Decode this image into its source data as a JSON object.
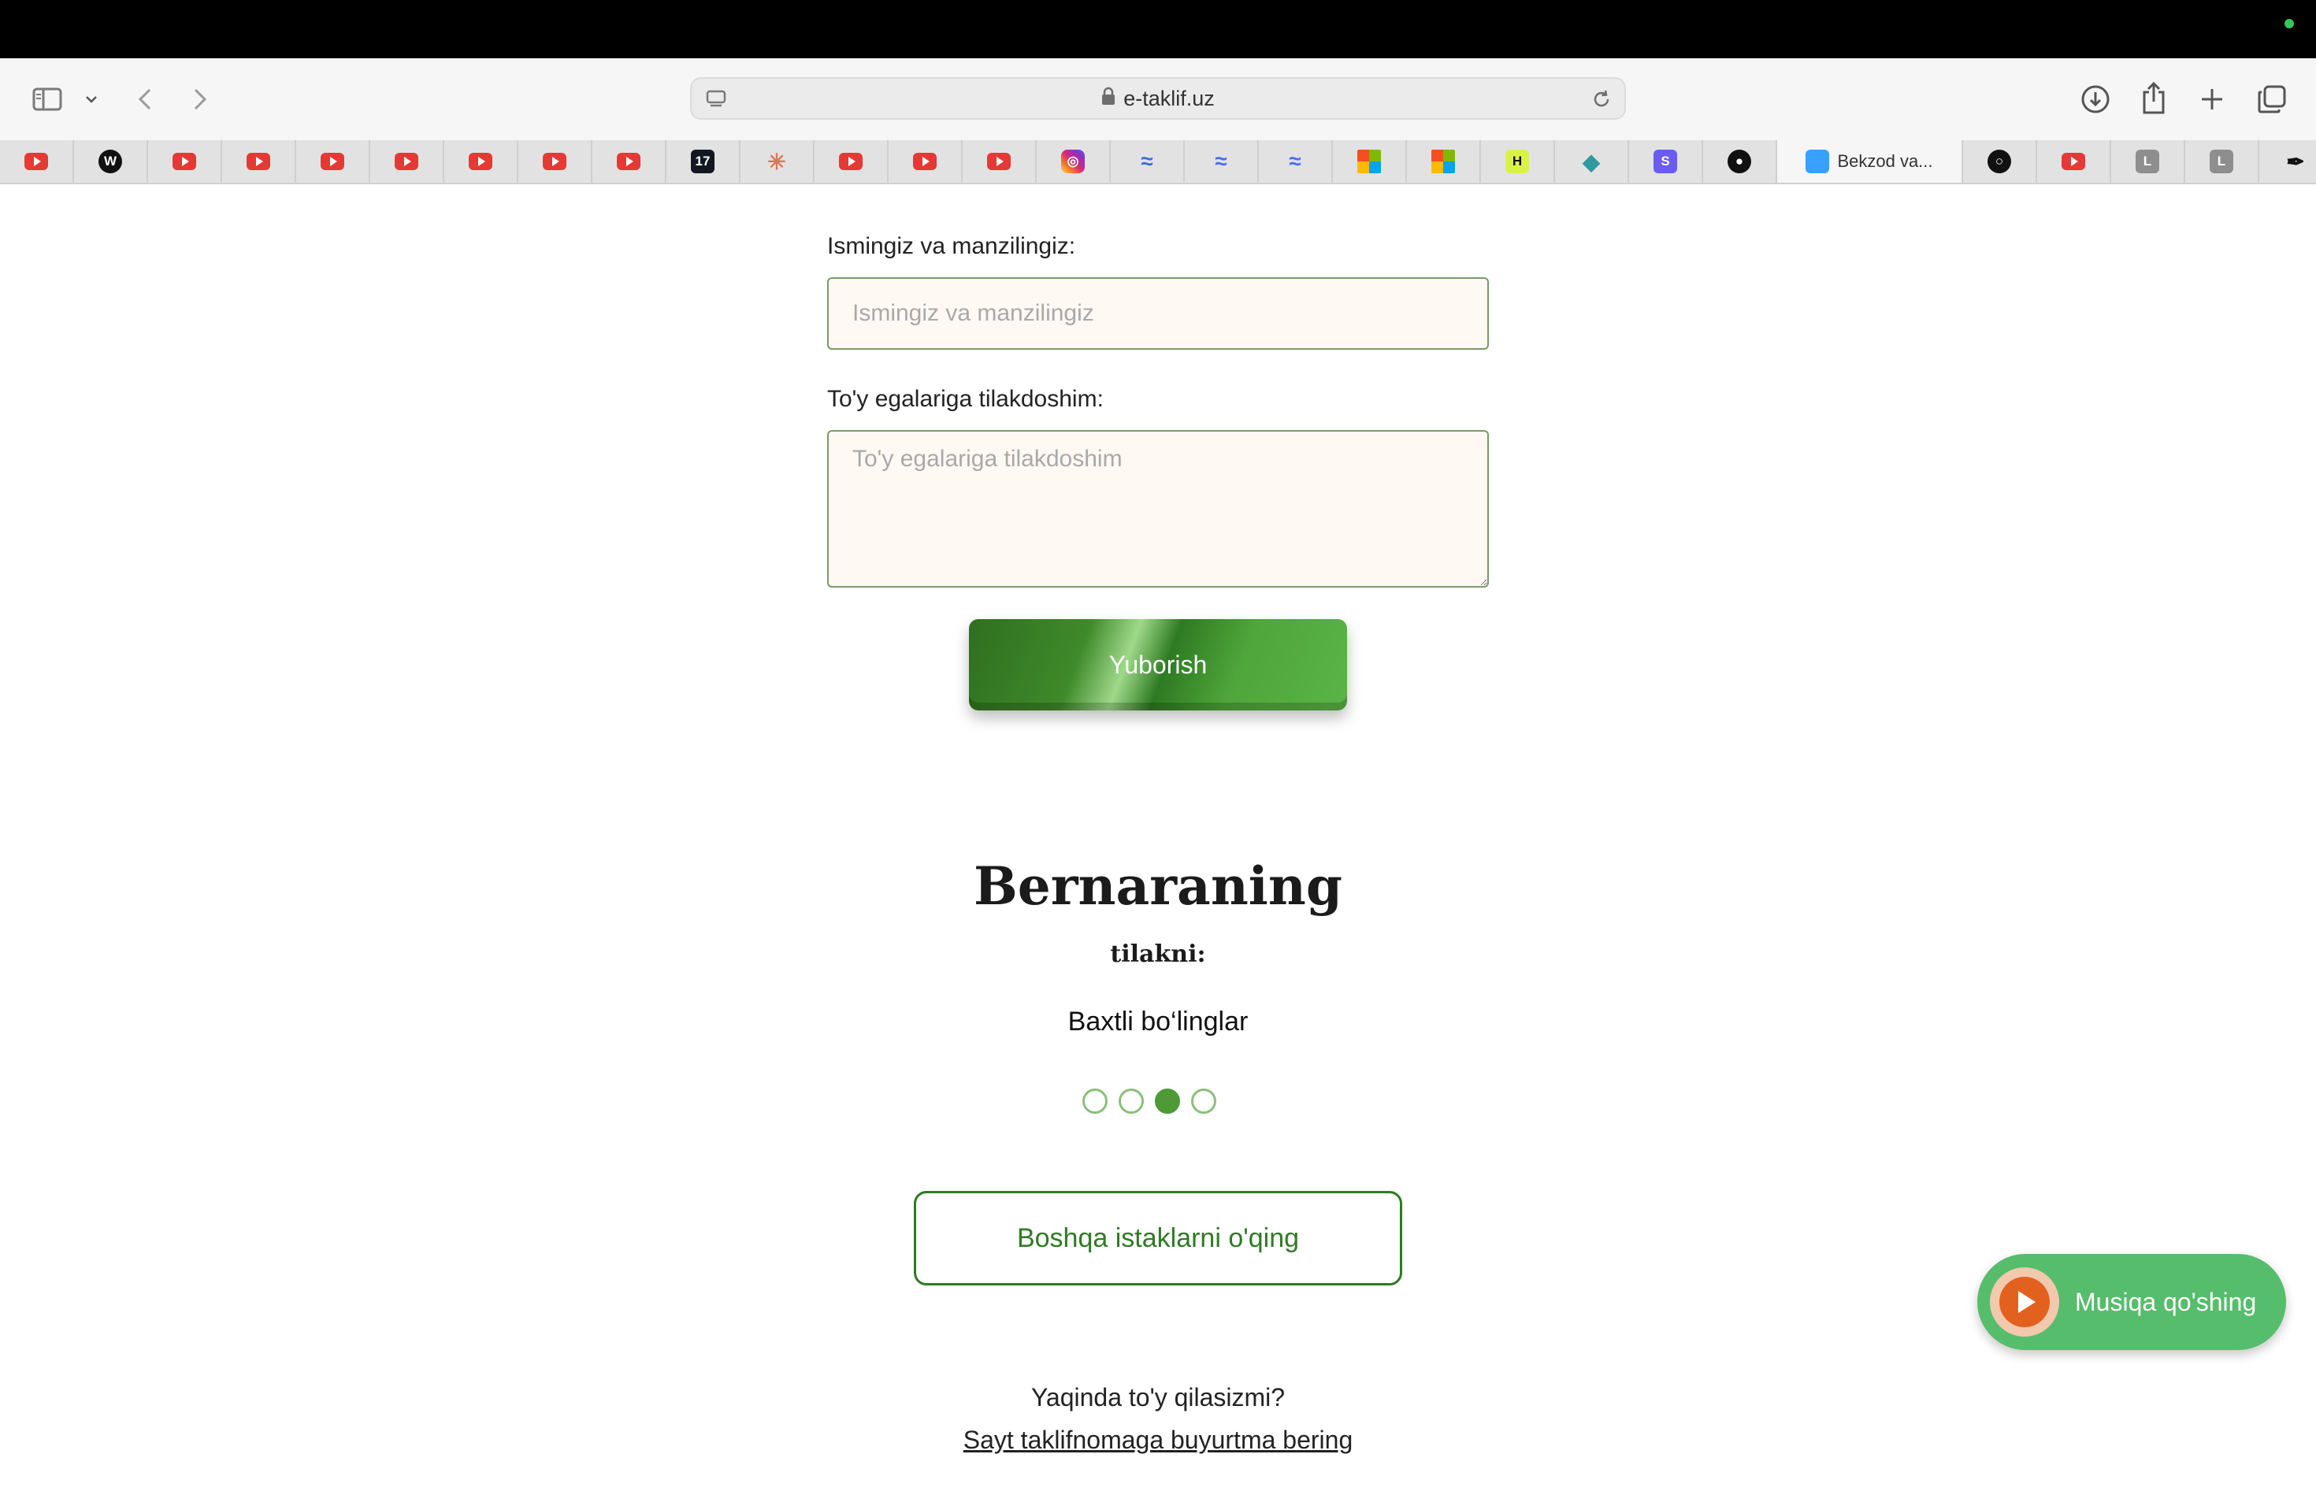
{
  "browser": {
    "url": "e-taklif.uz",
    "tabs": [
      {
        "icon": "youtube-icon",
        "color": "#e53935"
      },
      {
        "icon": "w-logo-icon",
        "text": "W",
        "color": "#111111"
      },
      {
        "icon": "youtube-icon",
        "color": "#e53935"
      },
      {
        "icon": "youtube-icon",
        "color": "#e53935"
      },
      {
        "icon": "youtube-icon",
        "color": "#e53935"
      },
      {
        "icon": "youtube-icon",
        "color": "#e53935"
      },
      {
        "icon": "youtube-icon",
        "color": "#e53935"
      },
      {
        "icon": "youtube-icon",
        "color": "#e53935"
      },
      {
        "icon": "youtube-icon",
        "color": "#e53935"
      },
      {
        "icon": "tradingview-icon",
        "text": "17",
        "color": "#131722"
      },
      {
        "icon": "claude-icon",
        "text": "✳",
        "color": "#d97757"
      },
      {
        "icon": "youtube-icon",
        "color": "#e53935"
      },
      {
        "icon": "youtube-icon",
        "color": "#e53935"
      },
      {
        "icon": "youtube-icon",
        "color": "#e53935"
      },
      {
        "icon": "instagram-icon",
        "color": "#d6249f"
      },
      {
        "icon": "waves-icon",
        "text": "≈",
        "color": "#3a6fd8"
      },
      {
        "icon": "deepseek-icon",
        "text": "≈",
        "color": "#4d6bfe"
      },
      {
        "icon": "deepseek-icon",
        "text": "≈",
        "color": "#4d6bfe"
      },
      {
        "icon": "microsoft-icon",
        "color": "#f25022"
      },
      {
        "icon": "microsoft-icon",
        "color": "#f25022"
      },
      {
        "icon": "h-logo-icon",
        "text": "H",
        "color": "#d9f24a"
      },
      {
        "icon": "diamond-icon",
        "text": "◆",
        "color": "#2e9aa0"
      },
      {
        "icon": "s-logo-icon",
        "text": "S",
        "color": "#6a5cf0"
      },
      {
        "icon": "github-icon",
        "text": "●",
        "color": "#111111"
      },
      {
        "icon": "site-icon",
        "label": "Bekzod va...",
        "active": true,
        "color": "#3aa0ff"
      },
      {
        "icon": "ring-icon",
        "text": "○",
        "color": "#111111"
      },
      {
        "icon": "youtube-icon",
        "color": "#e53935"
      },
      {
        "icon": "l-logo-icon",
        "text": "L",
        "color": "#8e8e8e"
      },
      {
        "icon": "l-logo-icon",
        "text": "L",
        "color": "#8e8e8e"
      },
      {
        "icon": "pen-icon",
        "text": "✒",
        "color": "#111111"
      }
    ]
  },
  "form": {
    "name_label": "Ismingiz va manzilingiz:",
    "name_placeholder": "Ismingiz va manzilingiz",
    "wish_label": "To'y egalariga tilakdoshim:",
    "wish_placeholder": "To'y egalariga tilakdoshim",
    "submit_label": "Yuborish"
  },
  "wishes": {
    "author": "Bernaraning",
    "subtitle": "tilakni:",
    "text": "Baxtli bo‘linglar",
    "pager": {
      "count": 4,
      "active_index": 2
    },
    "more_label": "Boshqa istaklarni o'qing"
  },
  "music": {
    "label": "Musiqa qo'shing"
  },
  "footer": {
    "question": "Yaqinda to'y qilasizmi?",
    "link": "Sayt taklifnomaga buyurtma bering"
  }
}
